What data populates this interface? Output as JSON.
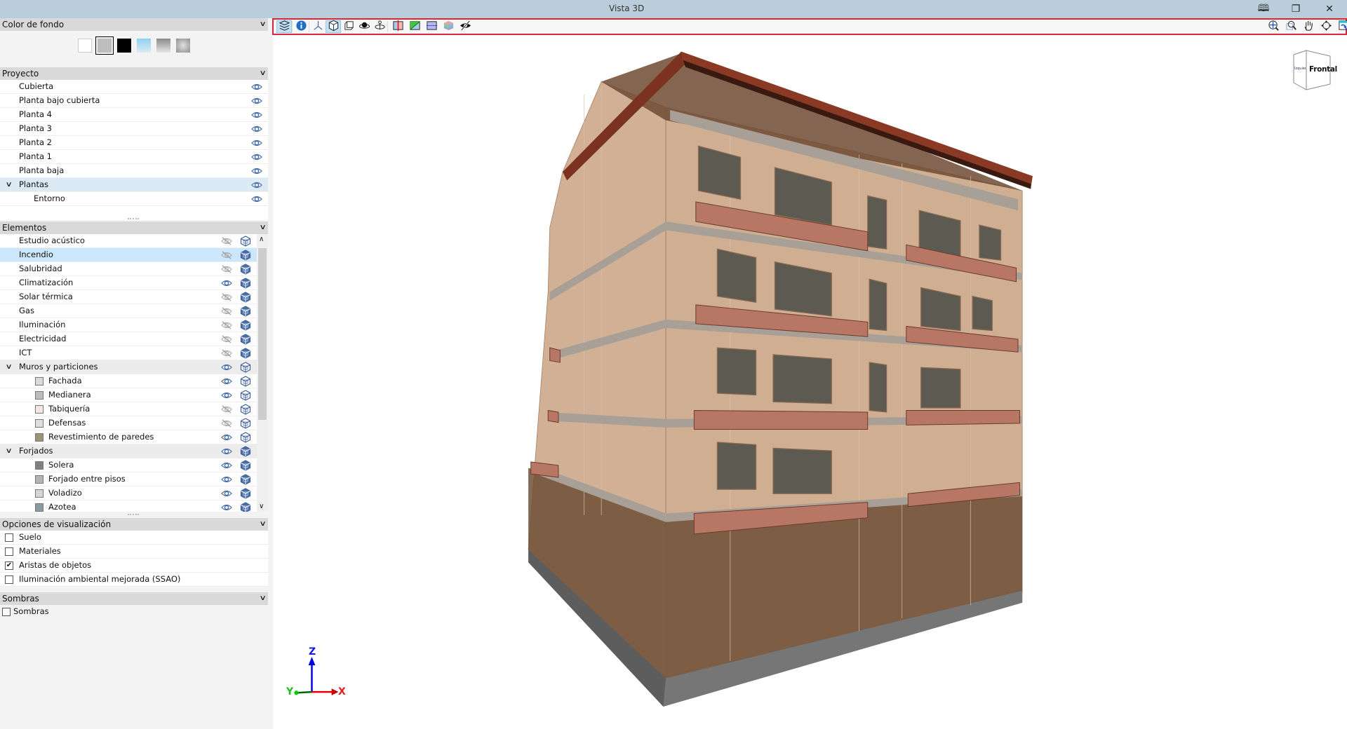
{
  "window": {
    "title": "Vista 3D",
    "buttons": [
      "book-icon",
      "restore-icon",
      "close-icon"
    ]
  },
  "background": {
    "header": "Color de fondo",
    "swatches": [
      {
        "name": "white",
        "color": "#ffffff"
      },
      {
        "name": "gray",
        "color": "#bdbdbd",
        "selected": true
      },
      {
        "name": "black",
        "color": "#000000"
      },
      {
        "name": "sky-gradient",
        "color": "#8fd0ef"
      },
      {
        "name": "gray-gradient",
        "color": "#8a8a8a"
      },
      {
        "name": "radial-gradient",
        "color": "#a0a0a0"
      }
    ]
  },
  "project": {
    "header": "Proyecto",
    "items": [
      {
        "label": "Cubierta",
        "level": 1
      },
      {
        "label": "Planta bajo cubierta",
        "level": 1
      },
      {
        "label": "Planta 4",
        "level": 1
      },
      {
        "label": "Planta 3",
        "level": 1
      },
      {
        "label": "Planta 2",
        "level": 1
      },
      {
        "label": "Planta 1",
        "level": 1
      },
      {
        "label": "Planta baja",
        "level": 1
      },
      {
        "label": "Plantas",
        "level": 0,
        "expanded": true,
        "selected": true
      },
      {
        "label": "Entorno",
        "level": 2
      }
    ]
  },
  "elements": {
    "header": "Elementos",
    "items": [
      {
        "label": "Estudio acústico",
        "visible": false,
        "solid": false
      },
      {
        "label": "Incendio",
        "visible": false,
        "solid": true,
        "selected": true
      },
      {
        "label": "Salubridad",
        "visible": false,
        "solid": true
      },
      {
        "label": "Climatización",
        "visible": true,
        "solid": true
      },
      {
        "label": "Solar térmica",
        "visible": false,
        "solid": true
      },
      {
        "label": "Gas",
        "visible": false,
        "solid": true
      },
      {
        "label": "Iluminación",
        "visible": false,
        "solid": true
      },
      {
        "label": "Electricidad",
        "visible": false,
        "solid": true
      },
      {
        "label": "ICT",
        "visible": false,
        "solid": true
      },
      {
        "label": "Muros y particiones",
        "group": true,
        "visible": true,
        "solid": false
      },
      {
        "label": "Fachada",
        "child": true,
        "color": "#d9d9d9",
        "visible": true,
        "solid": false
      },
      {
        "label": "Medianera",
        "child": true,
        "color": "#bdbdbd",
        "visible": true,
        "solid": false
      },
      {
        "label": "Tabiquería",
        "child": true,
        "color": "#f3e9e4",
        "visible": false,
        "solid": false
      },
      {
        "label": "Defensas",
        "child": true,
        "color": "#dedede",
        "visible": false,
        "solid": false
      },
      {
        "label": "Revestimiento de paredes",
        "child": true,
        "color": "#9a9474",
        "visible": true,
        "solid": false
      },
      {
        "label": "Forjados",
        "group": true,
        "visible": true,
        "solid": true
      },
      {
        "label": "Solera",
        "child": true,
        "color": "#808080",
        "visible": true,
        "solid": true
      },
      {
        "label": "Forjado entre pisos",
        "child": true,
        "color": "#b3b3b3",
        "visible": true,
        "solid": true
      },
      {
        "label": "Voladizo",
        "child": true,
        "color": "#d6d6d6",
        "visible": true,
        "solid": true
      },
      {
        "label": "Azotea",
        "child": true,
        "color": "#8a9aa1",
        "visible": true,
        "solid": true
      }
    ]
  },
  "display_options": {
    "header": "Opciones de visualización",
    "items": [
      {
        "label": "Suelo",
        "checked": false
      },
      {
        "label": "Materiales",
        "checked": false
      },
      {
        "label": "Aristas de objetos",
        "checked": true
      },
      {
        "label": "Iluminación ambiental mejorada (SSAO)",
        "checked": false
      }
    ]
  },
  "shadows": {
    "header": "Sombras",
    "items": [
      {
        "label": "Sombras",
        "checked": false
      }
    ]
  },
  "toolbar": {
    "left": [
      "layers-icon",
      "info-icon",
      "axes-icon",
      "cube-view-icon",
      "box-rotate-icon",
      "orbit-object-icon",
      "orbit-axis-icon",
      "section-x-icon",
      "section-diagonal-icon",
      "section-horizontal-icon",
      "colored-layers-icon",
      "hide-icon"
    ],
    "active": [
      "layers-icon",
      "cube-view-icon"
    ],
    "right": [
      "zoom-extents-icon",
      "zoom-window-icon",
      "pan-icon",
      "orbit-icon",
      "window-switch-icon"
    ]
  },
  "nav_cube": {
    "face_front": "Frontal",
    "face_side": "Izquierda"
  },
  "axes": {
    "z": "Z",
    "y": "Y",
    "x": "X"
  },
  "colors": {
    "accent_border": "#d6273a",
    "roof": "#7c3220",
    "facade": "#c49a78",
    "balcony": "#b87664",
    "slab": "#a59a8f"
  }
}
